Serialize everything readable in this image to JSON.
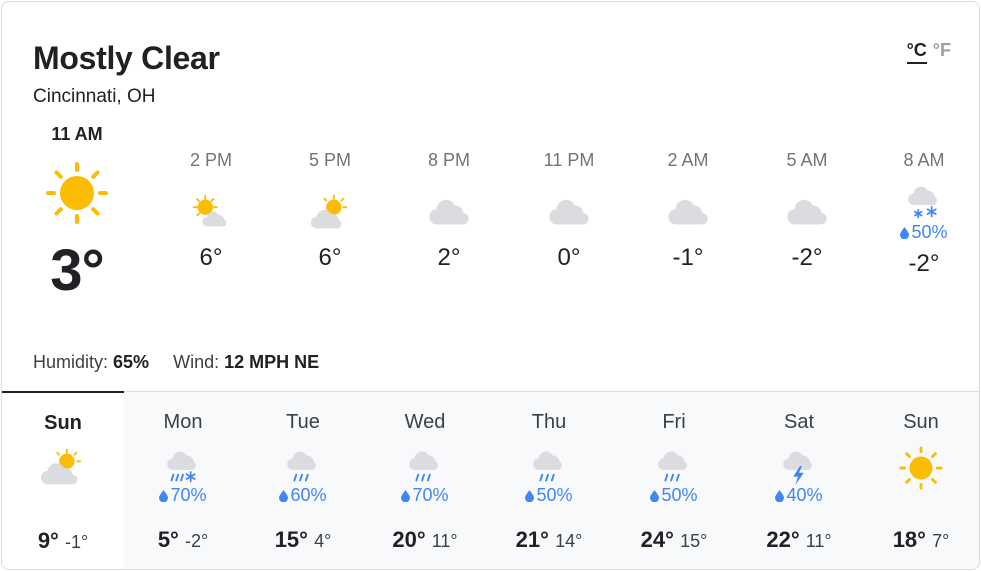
{
  "header": {
    "condition": "Mostly Clear",
    "location": "Cincinnati, OH",
    "unit_c": "°C",
    "unit_f": "°F"
  },
  "current": {
    "time": "11 AM",
    "icon": "sun-icon",
    "temp": "3°"
  },
  "hourly": [
    {
      "time": "2 PM",
      "icon": "partly-cloudy-icon",
      "temp": "6°",
      "precip": ""
    },
    {
      "time": "5 PM",
      "icon": "partly-cloudy-icon",
      "temp": "6°",
      "precip": ""
    },
    {
      "time": "8 PM",
      "icon": "cloud-icon",
      "temp": "2°",
      "precip": ""
    },
    {
      "time": "11 PM",
      "icon": "cloud-icon",
      "temp": "0°",
      "precip": ""
    },
    {
      "time": "2 AM",
      "icon": "cloud-icon",
      "temp": "-1°",
      "precip": ""
    },
    {
      "time": "5 AM",
      "icon": "cloud-icon",
      "temp": "-2°",
      "precip": ""
    },
    {
      "time": "8 AM",
      "icon": "snow-icon",
      "temp": "-2°",
      "precip": "50%"
    }
  ],
  "details": {
    "humidity_label": "Humidity:",
    "humidity": "65%",
    "wind_label": "Wind:",
    "wind": "12 MPH NE"
  },
  "daily": [
    {
      "day": "Sun",
      "icon": "partly-cloudy-icon",
      "precip": "",
      "hi": "9°",
      "lo": "-1°"
    },
    {
      "day": "Mon",
      "icon": "rain-snow-icon",
      "precip": "70%",
      "hi": "5°",
      "lo": "-2°"
    },
    {
      "day": "Tue",
      "icon": "rain-icon",
      "precip": "60%",
      "hi": "15°",
      "lo": "4°"
    },
    {
      "day": "Wed",
      "icon": "rain-icon",
      "precip": "70%",
      "hi": "20°",
      "lo": "11°"
    },
    {
      "day": "Thu",
      "icon": "rain-icon",
      "precip": "50%",
      "hi": "21°",
      "lo": "14°"
    },
    {
      "day": "Fri",
      "icon": "rain-icon",
      "precip": "50%",
      "hi": "24°",
      "lo": "15°"
    },
    {
      "day": "Sat",
      "icon": "thunderstorm-icon",
      "precip": "40%",
      "hi": "22°",
      "lo": "11°"
    },
    {
      "day": "Sun",
      "icon": "sun-icon",
      "precip": "",
      "hi": "18°",
      "lo": "7°"
    }
  ],
  "colors": {
    "sun": "#fbbc04",
    "cloud": "#dadce0",
    "precip": "#4285f4"
  }
}
